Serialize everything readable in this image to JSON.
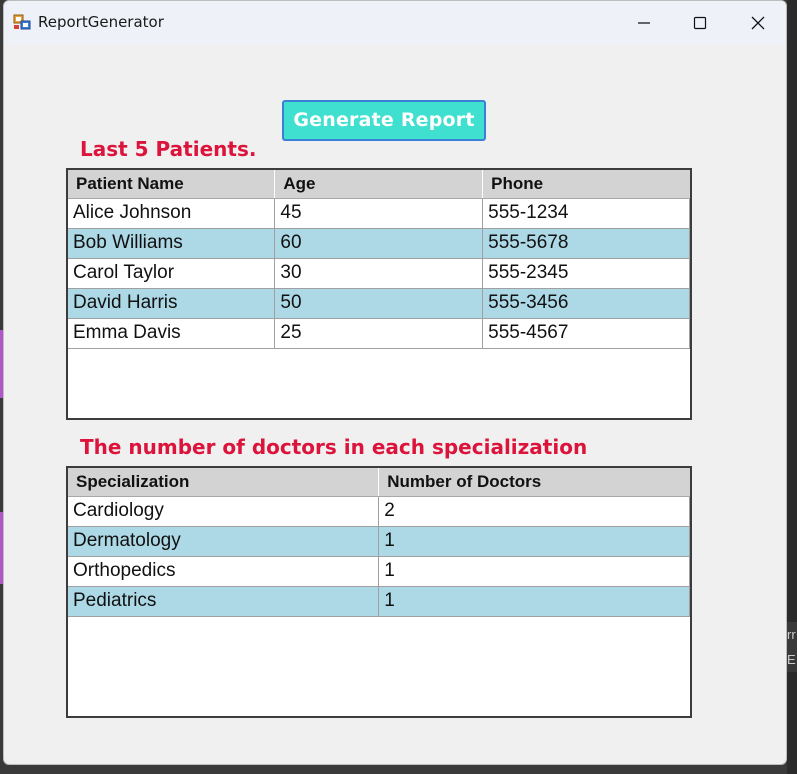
{
  "window": {
    "title": "ReportGenerator",
    "controls": {
      "minimize": "minimize",
      "maximize": "maximize",
      "close": "close"
    }
  },
  "toolbar": {
    "generate_label": "Generate Report"
  },
  "patients": {
    "heading": "Last 5 Patients.",
    "columns": [
      "Patient Name",
      "Age",
      "Phone"
    ],
    "rows": [
      [
        "Alice Johnson",
        "45",
        "555-1234"
      ],
      [
        "Bob Williams",
        "60",
        "555-5678"
      ],
      [
        "Carol Taylor",
        "30",
        "555-2345"
      ],
      [
        "David Harris",
        "50",
        "555-3456"
      ],
      [
        "Emma Davis",
        "25",
        "555-4567"
      ]
    ]
  },
  "doctors": {
    "heading": "The number of doctors in each specialization",
    "columns": [
      "Specialization",
      "Number of Doctors"
    ],
    "rows": [
      [
        "Cardiology",
        "2"
      ],
      [
        "Dermatology",
        "1"
      ],
      [
        "Orthopedics",
        "1"
      ],
      [
        "Pediatrics",
        "1"
      ]
    ]
  },
  "background": {
    "partial_text": [
      "rr",
      "E"
    ]
  },
  "colors": {
    "heading": "#dc143c",
    "button_bg": "#40e0d0",
    "button_border": "#3a80d6",
    "alt_row": "#add8e6",
    "header_bg": "#d3d3d3"
  }
}
